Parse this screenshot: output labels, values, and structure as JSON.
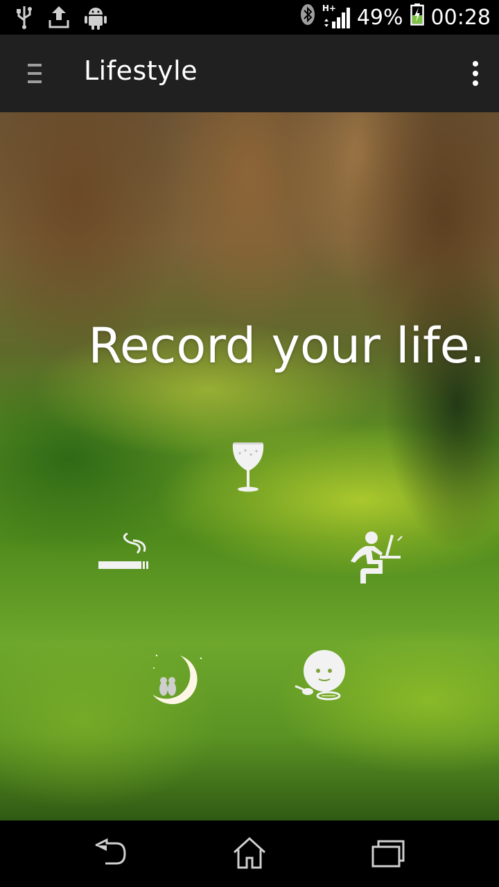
{
  "status_bar": {
    "left_icons": [
      "usb-icon",
      "upload-icon",
      "android-icon"
    ],
    "right_icons": [
      "bluetooth-icon",
      "signal-hplus-icon",
      "battery-charging-icon"
    ],
    "network_type": "H+",
    "battery_percent": "49%",
    "time": "00:28"
  },
  "app_bar": {
    "menu_icon": "hamburger-menu-icon",
    "title": "Lifestyle",
    "overflow_icon": "more-vert-icon"
  },
  "main": {
    "headline": "Record your life.",
    "activities": [
      {
        "name": "drinking",
        "icon": "wine-glass-icon"
      },
      {
        "name": "smoking",
        "icon": "cigarette-icon"
      },
      {
        "name": "working",
        "icon": "desk-work-icon"
      },
      {
        "name": "sleeping",
        "icon": "moon-sleep-icon"
      },
      {
        "name": "eating",
        "icon": "face-spoon-icon"
      }
    ]
  },
  "nav_bar": {
    "buttons": [
      "back-icon",
      "home-icon",
      "recent-apps-icon"
    ]
  },
  "colors": {
    "status_bg": "#000000",
    "appbar_bg": "#202020",
    "text": "#ffffff",
    "icon_fill": "#f2f2f2"
  }
}
